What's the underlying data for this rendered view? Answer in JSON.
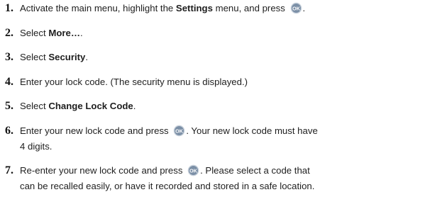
{
  "steps": [
    {
      "number": "1.",
      "pre": "Activate the main menu, highlight the ",
      "bold": "Settings",
      "post": " menu, and press ",
      "icon": "ok-key-icon",
      "end": "."
    },
    {
      "number": "2.",
      "pre": "Select ",
      "bold": "More…",
      "post": "."
    },
    {
      "number": "3.",
      "pre": "Select ",
      "bold": "Security",
      "post": "."
    },
    {
      "number": "4.",
      "text": "Enter your lock code. (The security menu is displayed.)"
    },
    {
      "number": "5.",
      "pre": "Select ",
      "bold": "Change Lock Code",
      "post": "."
    },
    {
      "number": "6.",
      "line1_pre": "Enter your new lock code and press ",
      "icon": "ok-key-icon",
      "line1_post": ". Your new lock code must have",
      "line2": "4 digits."
    },
    {
      "number": "7.",
      "line1_pre": "Re-enter your new lock code and press ",
      "icon": "ok-key-icon",
      "line1_post": ". Please select a code that",
      "line2": "can be recalled easily, or have it recorded and stored in a safe location."
    }
  ],
  "ok_icon": {
    "label": "OK",
    "fill": "#7b8fa6",
    "ring": "#c9d2dc",
    "text_color": "#ffffff"
  }
}
